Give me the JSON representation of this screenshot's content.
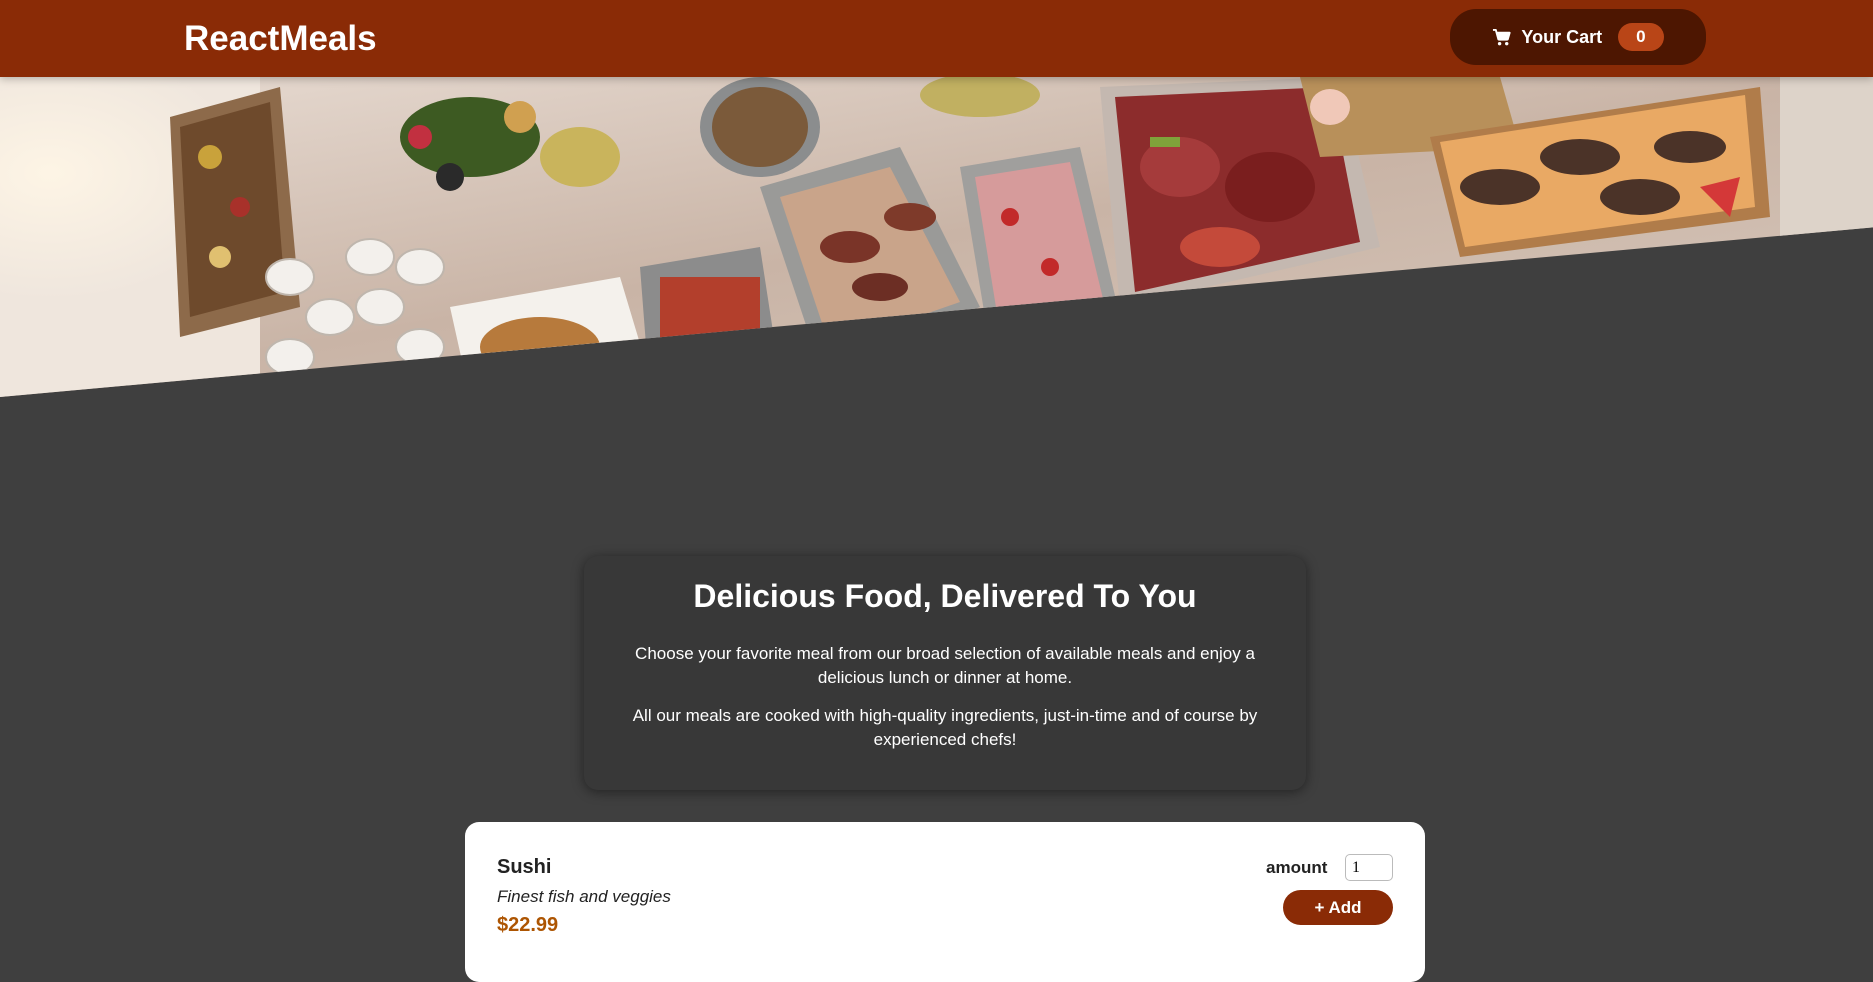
{
  "header": {
    "logo": "ReactMeals",
    "cart_label": "Your Cart",
    "cart_count": "0",
    "cart_icon": "shopping-cart-icon"
  },
  "colors": {
    "header_bg": "#8a2b06",
    "cart_button_bg": "#4d1601",
    "badge_bg": "#b94517",
    "page_bg": "#3f3f3f",
    "summary_bg": "#383838",
    "price": "#ad5502"
  },
  "summary": {
    "title": "Delicious Food, Delivered To You",
    "paragraph1": "Choose your favorite meal from our broad selection of available meals and enjoy a delicious lunch or dinner at home.",
    "paragraph2": "All our meals are cooked with high-quality ingredients, just-in-time and of course by experienced chefs!"
  },
  "meals": [
    {
      "name": "Sushi",
      "description": "Finest fish and veggies",
      "price": "$22.99",
      "amount_label": "amount",
      "amount_value": "1",
      "add_label": "+ Add"
    }
  ]
}
